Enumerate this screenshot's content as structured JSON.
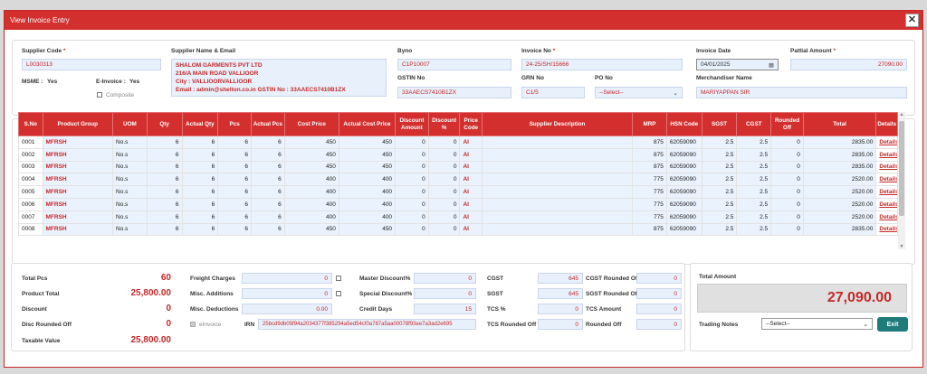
{
  "window": {
    "title": "View Invoice Entry",
    "close_icon": "✕"
  },
  "header": {
    "supplier_code_label": "Supplier Code",
    "supplier_code": "L0030313",
    "supplier_name_label": "Supplier Name & Email",
    "supplier_name": "SHALOM GARMENTS PVT LTD",
    "supplier_addr": "216/A MAIN ROAD VALLIOOR",
    "supplier_city": "City : VALLIOORVALLIOOR",
    "supplier_email": "Email : admin@shelton.co.in   GSTIN No : 33AAECS7410B1ZX",
    "byno_label": "Byno",
    "byno": "C1P10007",
    "invoice_no_label": "Invoice No",
    "invoice_no": "24-25/SH/15666",
    "invoice_date_label": "Invoice Date",
    "invoice_date": "04/01/2025",
    "partial_amount_label": "Pattial Amount",
    "partial_amount": "27090.00",
    "msme_label": "MSME :",
    "msme": "Yes",
    "einvoice_label": "E-Invoice :",
    "einvoice": "Yes",
    "composite_label": "Composite",
    "gstin_label": "GSTIN No",
    "gstin": "33AAECS7410B1ZX",
    "grn_label": "GRN No",
    "grn": "C1/5",
    "po_label": "PO No",
    "po": "--Select--",
    "merch_label": "Merchandiser Name",
    "merch": "MARIYAPPAN SIR"
  },
  "columns": [
    "S.No",
    "Product Group",
    "UOM",
    "Qty",
    "Actual Qty",
    "Pcs",
    "Actual Pcs",
    "Cost Price",
    "Actual Cost Price",
    "Discount Amount",
    "Discount %",
    "Price Code",
    "Supplier Description",
    "MRP",
    "HSN Code",
    "SGST",
    "CGST",
    "Rounded Off",
    "Total",
    "Details"
  ],
  "rows": [
    [
      "0001",
      "MFRSH",
      "No.s",
      "6",
      "6",
      "6",
      "6",
      "450",
      "450",
      "0",
      "0",
      "AI",
      "",
      "875",
      "62059090",
      "2.5",
      "2.5",
      "0",
      "2835.00",
      "Details"
    ],
    [
      "0002",
      "MFRSH",
      "No.s",
      "6",
      "6",
      "6",
      "6",
      "450",
      "450",
      "0",
      "0",
      "AI",
      "",
      "875",
      "62059090",
      "2.5",
      "2.5",
      "0",
      "2835.00",
      "Details"
    ],
    [
      "0003",
      "MFRSH",
      "No.s",
      "6",
      "6",
      "6",
      "6",
      "450",
      "450",
      "0",
      "0",
      "AI",
      "",
      "875",
      "62059090",
      "2.5",
      "2.5",
      "0",
      "2835.00",
      "Details"
    ],
    [
      "0004",
      "MFRSH",
      "No.s",
      "6",
      "6",
      "6",
      "6",
      "400",
      "400",
      "0",
      "0",
      "AI",
      "",
      "775",
      "62059090",
      "2.5",
      "2.5",
      "0",
      "2520.00",
      "Details"
    ],
    [
      "0005",
      "MFRSH",
      "No.s",
      "6",
      "6",
      "6",
      "6",
      "400",
      "400",
      "0",
      "0",
      "AI",
      "",
      "775",
      "62059090",
      "2.5",
      "2.5",
      "0",
      "2520.00",
      "Details"
    ],
    [
      "0006",
      "MFRSH",
      "No.s",
      "6",
      "6",
      "6",
      "6",
      "400",
      "400",
      "0",
      "0",
      "AI",
      "",
      "775",
      "62059090",
      "2.5",
      "2.5",
      "0",
      "2520.00",
      "Details"
    ],
    [
      "0007",
      "MFRSH",
      "No.s",
      "6",
      "6",
      "6",
      "6",
      "400",
      "400",
      "0",
      "0",
      "AI",
      "",
      "775",
      "62059090",
      "2.5",
      "2.5",
      "0",
      "2520.00",
      "Details"
    ],
    [
      "0008",
      "MFRSH",
      "No.s",
      "6",
      "6",
      "6",
      "6",
      "450",
      "450",
      "0",
      "0",
      "AI",
      "",
      "875",
      "62059090",
      "2.5",
      "2.5",
      "0",
      "2835.00",
      "Details"
    ]
  ],
  "footer": {
    "total_pcs_label": "Total Pcs",
    "total_pcs": "60",
    "product_total_label": "Product Total",
    "product_total": "25,800.00",
    "discount_label": "Discount",
    "discount": "0",
    "disc_rounded_label": "Disc Rounded Off",
    "disc_rounded": "0",
    "taxable_label": "Taxable Value",
    "taxable": "25,800.00",
    "freight_label": "Freight Charges",
    "freight": "0",
    "misc_add_label": "Misc. Additions",
    "misc_add": "0",
    "misc_ded_label": "Misc. Deductions",
    "misc_ded": "0.00",
    "einvoice_label": "eInvoice",
    "irn_label": "IRN",
    "irn": "25bcd9db05f94a2034377f385294a5ed54cf0a787a5aa00078f93ee7a3ad2e695",
    "master_disc_label": "Master Discount%",
    "master_disc": "0",
    "special_disc_label": "Special Discount%",
    "special_disc": "0",
    "credit_days_label": "Credit Days",
    "credit_days": "15",
    "cgst_label": "CGST",
    "cgst": "645",
    "sgst_label": "SGST",
    "sgst": "645",
    "tcs_pct_label": "TCS %",
    "tcs_pct": "0",
    "tcs_round_label": "TCS Rounded Off",
    "tcs_round": "0",
    "cgst_round_label": "CGST Rounded Off",
    "cgst_round": "0",
    "sgst_round_label": "SGST Rounded Off",
    "sgst_round": "0",
    "tcs_amt_label": "TCS Amount",
    "tcs_amt": "0",
    "rounded_label": "Rounded Off",
    "rounded": "0",
    "total_amount_label": "Total Amount",
    "total_amount": "27,090.00",
    "trading_notes_label": "Trading Notes",
    "trading_notes": "--Select--",
    "exit_label": "Exit"
  }
}
